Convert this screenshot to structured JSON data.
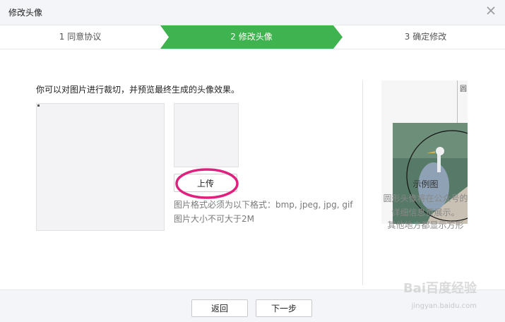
{
  "dialog": {
    "title": "修改头像",
    "close_icon": "close-icon"
  },
  "steps": [
    {
      "label": "1 同意协议",
      "active": false
    },
    {
      "label": "2 修改头像",
      "active": true
    },
    {
      "label": "3 确定修改",
      "active": false
    }
  ],
  "colors": {
    "active_step": "#3fb34f",
    "annotation": "#e0207f"
  },
  "editor": {
    "intro": "你可以对图片进行裁切，并预览最终生成的头像效果。",
    "upload_label": "上传",
    "hint_format": "图片格式必须为以下格式：bmp, jpeg, jpg, gif",
    "hint_size": "图片大小不可大于2M"
  },
  "example": {
    "caption": "示例图",
    "line1": "圆形头像将在公众号的",
    "line2": "详细信息页展示。",
    "line3": "其他地方都显示方形",
    "corner_text": "圆"
  },
  "footer": {
    "back_label": "返回",
    "next_label": "下一步"
  },
  "watermark": {
    "text": "Bai百度经验",
    "url": "jingyan.baidu.com"
  }
}
